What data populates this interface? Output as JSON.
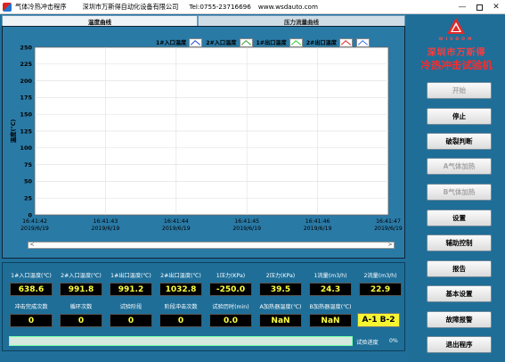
{
  "window": {
    "title": "气体冷热冲击程序",
    "company": "深圳市万斯得自动化设备有限公司",
    "tel": "Tel:0755-23716696",
    "website": "www.wsdauto.com",
    "controls": {
      "minimize": "—",
      "close": "✕"
    }
  },
  "tabs": [
    {
      "label": "温度曲线",
      "active": true
    },
    {
      "label": "压力流量曲线",
      "active": false
    }
  ],
  "legend": [
    {
      "label": "1#入口温度",
      "color": "#1a3fd6"
    },
    {
      "label": "2#入口温度",
      "color": "#2e9c2e"
    },
    {
      "label": "1#出口温度",
      "color": "#2ad12a"
    },
    {
      "label": "2#出口温度",
      "color": "#e02020"
    },
    {
      "label": "",
      "color": "#3a70e0"
    }
  ],
  "chart_data": {
    "type": "line",
    "title": "",
    "ylabel": "温度(℃)",
    "xlabel": "",
    "ylim": [
      0,
      250
    ],
    "yticks": [
      0,
      25,
      50,
      75,
      100,
      125,
      150,
      175,
      200,
      225,
      250
    ],
    "x_ticks": [
      {
        "time": "16:41:42",
        "date": "2019/6/19"
      },
      {
        "time": "16:41:43",
        "date": "2019/6/19"
      },
      {
        "time": "16:41:44",
        "date": "2019/6/19"
      },
      {
        "time": "16:41:45",
        "date": "2019/6/19"
      },
      {
        "time": "16:41:46",
        "date": "2019/6/19"
      },
      {
        "time": "16:41:47",
        "date": "2019/6/19"
      }
    ],
    "grid": true,
    "series": []
  },
  "scrollbar": {
    "left": "<",
    "right": ">"
  },
  "readings_row1": [
    {
      "label": "1#入口温度(℃)",
      "value": "638.6"
    },
    {
      "label": "2#入口温度(℃)",
      "value": "991.8"
    },
    {
      "label": "1#出口温度(℃)",
      "value": "991.2"
    },
    {
      "label": "2#出口温度(℃)",
      "value": "1032.8"
    },
    {
      "label": "1压力(KPa)",
      "value": "-250.0"
    },
    {
      "label": "2压力(KPa)",
      "value": "39.5"
    },
    {
      "label": "1流量(m3/h)",
      "value": "24.3"
    },
    {
      "label": "2流量(m3/h)",
      "value": "22.9"
    }
  ],
  "readings_row2": [
    {
      "label": "冲击完成次数",
      "value": "0"
    },
    {
      "label": "循环次数",
      "value": "0"
    },
    {
      "label": "试验阶段",
      "value": "0"
    },
    {
      "label": "阶段冲击次数",
      "value": "0"
    },
    {
      "label": "试验历时(min)",
      "value": "0.0"
    },
    {
      "label": "A加热器温度(℃)",
      "value": "NaN"
    },
    {
      "label": "B加热器温度(℃)",
      "value": "NaN"
    }
  ],
  "ab_status": "A-1 B-2",
  "progress": {
    "label": "试验进度",
    "value": 0,
    "text": "0%"
  },
  "right_panel": {
    "brand_en": "WISDOM",
    "brand_cn": "深圳市万斯得",
    "app_title": "冷热冲击试验机",
    "buttons": [
      {
        "label": "开始",
        "enabled": false
      },
      {
        "label": "停止",
        "enabled": true
      },
      {
        "label": "破裂判断",
        "enabled": true
      },
      {
        "label": "A气体加热",
        "enabled": false
      },
      {
        "label": "B气体加热",
        "enabled": false
      },
      {
        "label": "设置",
        "enabled": true
      },
      {
        "label": "辅助控制",
        "enabled": true
      },
      {
        "label": "报告",
        "enabled": true
      },
      {
        "label": "基本设置",
        "enabled": true
      },
      {
        "label": "故障报警",
        "enabled": true
      },
      {
        "label": "退出程序",
        "enabled": true
      }
    ]
  }
}
